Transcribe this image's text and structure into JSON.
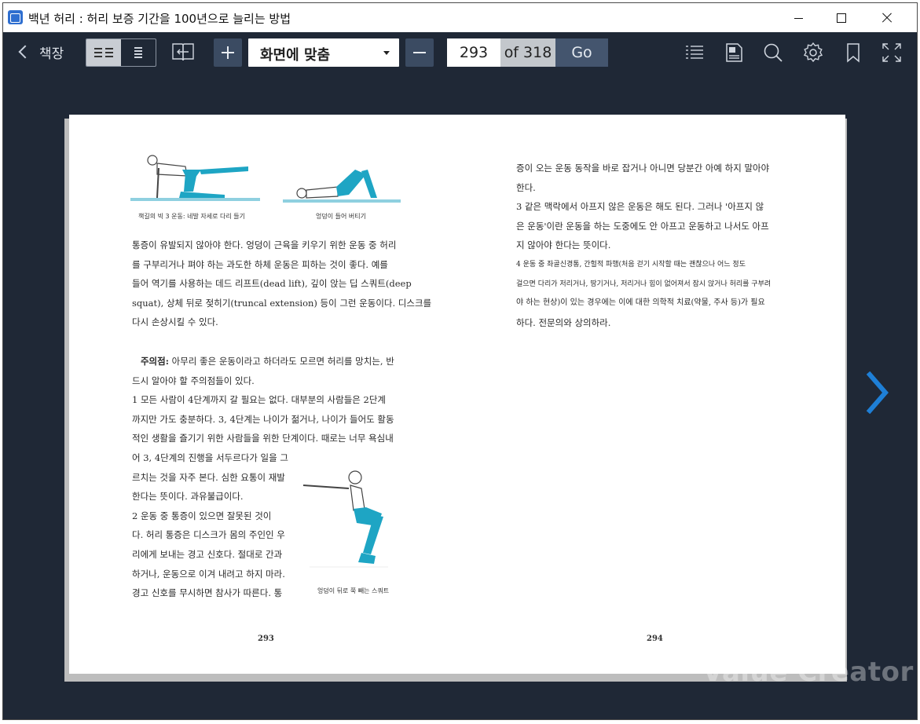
{
  "window": {
    "title": "백년 허리 : 허리 보증 기간을 100년으로 늘리는 방법"
  },
  "toolbar": {
    "back_label": "책장",
    "zoom_value": "화면에 맞춤",
    "page_current": "293",
    "page_total": "of 318",
    "go_label": "Go",
    "icons": [
      "list-view-icon",
      "single-column-icon",
      "toc-book-icon",
      "zoom-in-icon",
      "zoom-out-icon",
      "toc-list-icon",
      "notes-icon",
      "search-icon",
      "settings-icon",
      "bookmark-icon",
      "fullscreen-icon"
    ]
  },
  "left_page": {
    "caption_1": "책길의 빅 3 운동: 네발 자세로 다리 들기",
    "caption_2": "엉덩이 들어 버티기",
    "caption_3": "엉덩이 뒤로 쭉 빼는 스쿼트",
    "p1": [
      "통증이 유발되지 않아야 한다. 엉덩이 근육을 키우기 위한 운동 중 허리",
      "를 구부리거나 펴야 하는 과도한 하체 운동은 피하는 것이 좋다. 예를",
      "들어 역기를 사용하는 데드 리프트(dead lift), 깊이 앉는 딥 스쿼트(deep",
      "squat), 상체 뒤로 젖히기(truncal extension) 등이 그런 운동이다. 디스크를",
      "다시 손상시킬 수 있다."
    ],
    "caution_label": "주의점:",
    "p2_first": " 아무리 좋은 운동이라고 하더라도 모르면 허리를 망치는, 반",
    "p2": [
      "드시 알아야 할 주의점들이 있다.",
      "1  모든 사람이 4단계까지 갈 필요는 없다. 대부분의 사람들은 2단계",
      "까지만 가도 충분하다. 3, 4단계는 나이가 젊거나, 나이가 들어도 활동",
      "적인 생활을 즐기기 위한 사람들을 위한 단계이다. 때로는 너무 욕심내",
      "어 3, 4단계의 진행을 서두르다가 일을 그",
      "르치는 것을 자주 본다. 심한 요통이 재발",
      "한다는 뜻이다. 과유불급이다.",
      "2  운동 중 통증이 있으면 잘못된 것이",
      "다. 허리 통증은 디스크가 몸의 주인인 우",
      "리에게 보내는 경고 신호다. 절대로 간과",
      "하거나, 운동으로 이겨 내려고 하지 마라.",
      "경고 신호를 무시하면 참사가 따른다. 통"
    ],
    "page_number": "293"
  },
  "right_page": {
    "lines": [
      "증이 오는 운동 동작을 바로 잡거나 아니면 당분간 아예 하지 말아야",
      "한다.",
      "3  같은 맥락에서 아프지 않은 운동은 해도 된다. 그러나 '아프지 않",
      "은 운동'이란 운동을 하는 도중에도 안 아프고 운동하고 나서도 아프",
      "지 않아야 한다는 뜻이다.",
      "4  운동 중 좌골신경통, 간헐적 파행(처음 걷기 시작할 때는 괜찮으나 어느 정도",
      "걸으면 다리가 저리거나, 땅기거나, 저리거나 힘이 없어져서 잠시 앉거나 허리를 구부려",
      "야 하는 현상)이 있는 경우에는 이에 대한 의학적 치료(약물, 주사 등)가 필요",
      "하다. 전문의와 상의하라."
    ],
    "page_number": "294"
  },
  "watermark": "Value Creator",
  "colors": {
    "accent": "#1e7fd6",
    "toolbar_bg": "#1f2836",
    "figure": "#1ea5c4"
  }
}
